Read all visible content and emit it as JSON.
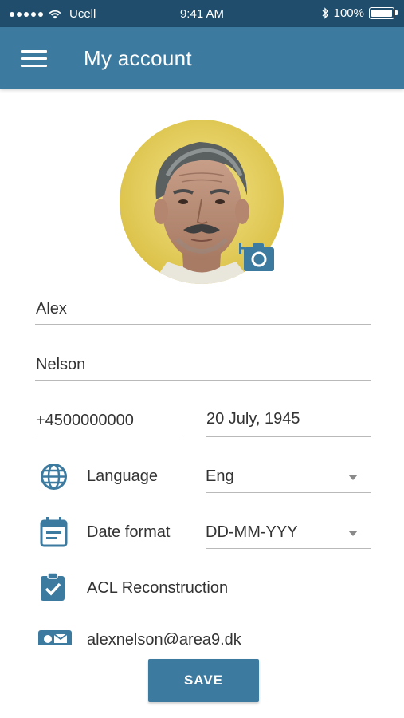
{
  "status_bar": {
    "carrier": "Ucell",
    "time": "9:41 AM",
    "battery": "100%"
  },
  "header": {
    "title": "My account",
    "menu_icon": "hamburger-menu-icon"
  },
  "profile": {
    "photo_icon": "user-photo",
    "camera_icon": "add-photo-camera-icon"
  },
  "form": {
    "first_name": "Alex",
    "last_name": "Nelson",
    "phone": "+4500000000",
    "birth_date": "20 July, 1945",
    "language": {
      "label": "Language",
      "value": "Eng",
      "icon": "globe-icon"
    },
    "date_format": {
      "label": "Date format",
      "value": "DD-MM-YYY",
      "icon": "calendar-icon"
    },
    "condition": {
      "label": "ACL Reconstruction",
      "icon": "clipboard-check-icon"
    },
    "email": {
      "value": "alexnelson@area9.dk",
      "icon": "id-card-icon"
    }
  },
  "actions": {
    "save_label": "SAVE"
  },
  "colors": {
    "status_bar": "#1f4d6b",
    "app_bar": "#3d7aa0",
    "accent": "#3d7aa0",
    "divider": "#b9b9b9",
    "text": "#333333"
  }
}
